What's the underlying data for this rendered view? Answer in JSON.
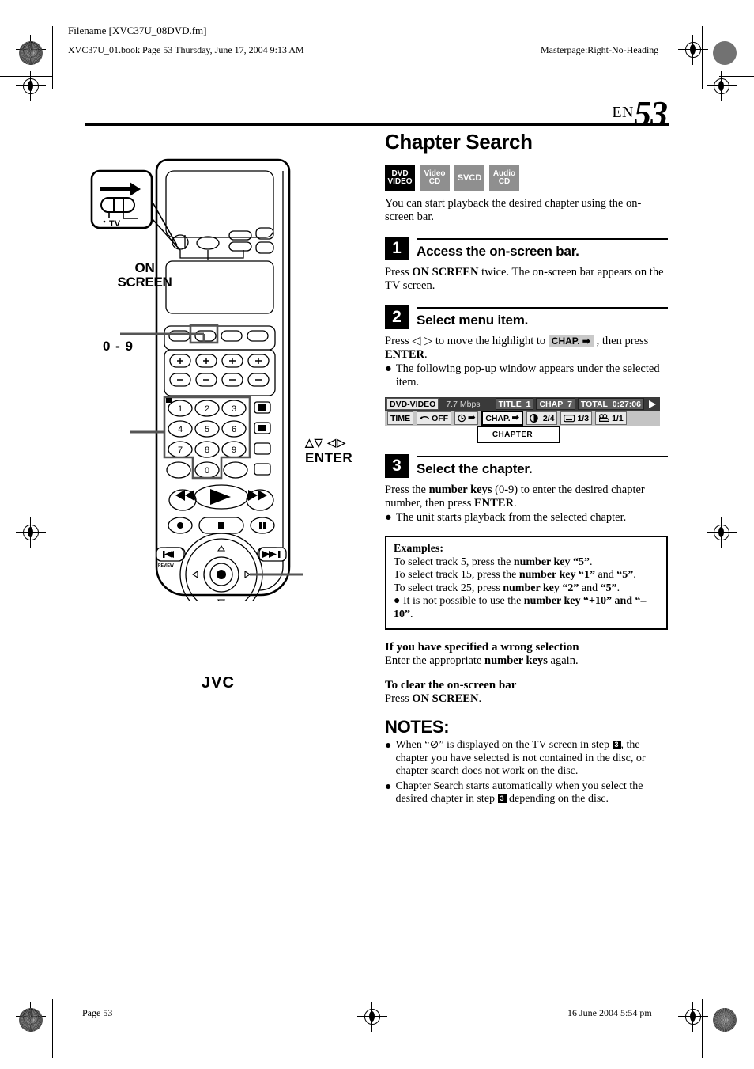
{
  "page": {
    "slug_filename": "Filename [XVC37U_08DVD.fm]",
    "slug_book": "XVC37U_01.book  Page 53  Thursday, June 17, 2004  9:13 AM",
    "slug_masterpage": "Masterpage:Right-No-Heading",
    "footer_page": "Page 53",
    "footer_date": "16 June 2004 5:54 pm",
    "lang_code": "EN",
    "page_number": "53"
  },
  "content": {
    "title": "Chapter Search",
    "badges": [
      {
        "name": "dvd-video",
        "line1": "DVD",
        "line2": "VIDEO",
        "active": true
      },
      {
        "name": "video-cd",
        "line1": "Video",
        "line2": "CD",
        "active": false
      },
      {
        "name": "svcd",
        "line1": "SVCD",
        "line2": "",
        "active": false
      },
      {
        "name": "audio-cd",
        "line1": "Audio",
        "line2": "CD",
        "active": false
      }
    ],
    "intro": "You can start playback the desired chapter using the on-screen bar.",
    "steps": [
      {
        "number": "1",
        "heading": "Access the on-screen bar.",
        "body_pre": "Press ",
        "body_bold": "ON SCREEN",
        "body_post": " twice. The on-screen bar appears on the TV screen."
      },
      {
        "number": "2",
        "heading": "Select menu item.",
        "body_pre": "Press ",
        "arrows": "◁ ▷",
        "body_mid": " to move the highlight to ",
        "chip": "CHAP.",
        "body_mid2": " , then press ",
        "body_bold": "ENTER",
        "body_post": ".",
        "bullet": "The following pop-up window appears under the selected item."
      },
      {
        "number": "3",
        "heading": "Select the chapter.",
        "body_pre": "Press the ",
        "body_bold": "number keys",
        "body_mid": " (0-9) to enter the desired chapter number, then press ",
        "body_bold2": "ENTER",
        "body_post": ".",
        "bullet": "The unit starts playback from the selected chapter."
      }
    ],
    "osd": {
      "disc_type": "DVD-VIDEO",
      "bitrate": "7.7 Mbps",
      "title_label": "TITLE",
      "title_value": "1",
      "chap_label": "CHAP",
      "chap_value": "7",
      "total_label": "TOTAL",
      "total_value": "0:27:06",
      "play_icon": "play-icon",
      "buttons": [
        {
          "name": "time",
          "label": "TIME",
          "icon": "",
          "selected": false
        },
        {
          "name": "repeat-off",
          "label": "OFF",
          "icon": "repeat-icon",
          "selected": false
        },
        {
          "name": "time-search",
          "label": "",
          "icon": "clock-arrow-icon",
          "selected": false
        },
        {
          "name": "chapter-search",
          "label": "CHAP.",
          "icon": "arrow-right-icon",
          "selected": true
        },
        {
          "name": "audio",
          "label": "2/4",
          "icon": "audio-icon",
          "selected": false
        },
        {
          "name": "subtitle",
          "label": "1/3",
          "icon": "subtitle-icon",
          "selected": false
        },
        {
          "name": "angle",
          "label": "1/1",
          "icon": "angle-camera-icon",
          "selected": false
        }
      ],
      "popup_label": "CHAPTER __"
    },
    "examples": {
      "heading": "Examples:",
      "lines": [
        {
          "pre": "To select track 5, press the ",
          "bold": "number key “5”",
          "post": "."
        },
        {
          "pre": "To select track 15, press the ",
          "bold": "number key “1”",
          "mid": " and ",
          "bold2": "“5”",
          "post": "."
        },
        {
          "pre": "To select track 25, press ",
          "bold": "number key “2”",
          "mid": " and ",
          "bold2": "“5”",
          "post": "."
        }
      ],
      "bullet_pre": "It is not possible to use the ",
      "bullet_bold": "number key “+10” and “–10”",
      "bullet_post": "."
    },
    "sub_wrong": {
      "heading": "If you have specified a wrong selection",
      "body_pre": "Enter the appropriate ",
      "body_bold": "number keys",
      "body_post": " again."
    },
    "sub_clear": {
      "heading": "To clear the on-screen bar",
      "body_pre": "Press ",
      "body_bold": "ON SCREEN",
      "body_post": "."
    },
    "notes": {
      "heading": "NOTES:",
      "items": [
        {
          "pre": "When “⊘” is displayed on the TV screen in step ",
          "chip": "3",
          "post": ", the chapter you have selected is not contained in the disc, or chapter search does not work on the disc."
        },
        {
          "pre": "Chapter Search starts automatically when you select the desired chapter in step ",
          "chip": "3",
          "post": " depending on the disc."
        }
      ]
    }
  },
  "remote": {
    "callout_on_screen": "ON\nSCREEN",
    "callout_on_screen_line1": "ON",
    "callout_on_screen_line2": "SCREEN",
    "callout_number_keys": "0 - 9",
    "callout_enter": "ENTER",
    "callout_arrows": "△▽ ◁▷",
    "tv_switch_label": "TV",
    "brand": "JVC",
    "number_keys": [
      "1",
      "2",
      "3",
      "4",
      "5",
      "6",
      "7",
      "8",
      "9",
      "0"
    ],
    "review_label": "REVIEW"
  }
}
